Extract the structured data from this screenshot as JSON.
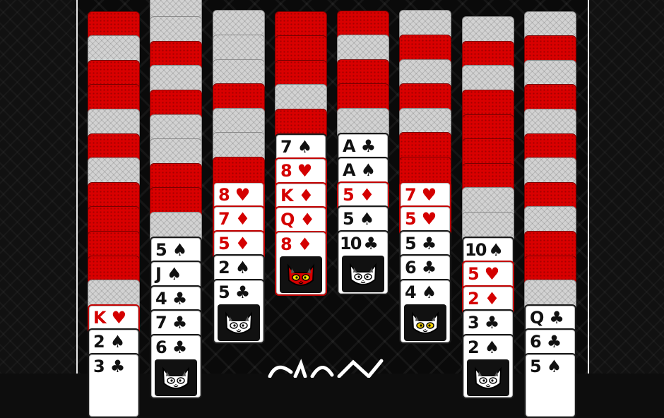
{
  "colors": {
    "back_red": "#d90000",
    "back_grey": "#d2d2d2",
    "board": "#0a0a0a",
    "red_suit": "#d40000",
    "black_suit": "#111111"
  },
  "columns": [
    {
      "backs": [
        "red",
        "grey",
        "red",
        "red",
        "grey",
        "red",
        "grey",
        "red",
        "red",
        "red",
        "red",
        "grey"
      ],
      "faces": [
        {
          "rank": "K",
          "suit": "♥"
        },
        {
          "rank": "2",
          "suit": "♠"
        },
        {
          "rank": "3",
          "suit": "♣"
        }
      ]
    },
    {
      "backs": [
        "grey",
        "grey",
        "red",
        "grey",
        "red",
        "grey",
        "grey",
        "red",
        "red",
        "grey"
      ],
      "faces": [
        {
          "rank": "5",
          "suit": "♠"
        },
        {
          "rank": "J",
          "suit": "♠"
        },
        {
          "rank": "4",
          "suit": "♣"
        },
        {
          "rank": "7",
          "suit": "♣"
        },
        {
          "rank": "6",
          "suit": "♣"
        }
      ],
      "cat": "white-cat-icon"
    },
    {
      "backs": [
        "grey",
        "grey",
        "grey",
        "red",
        "grey",
        "grey",
        "red"
      ],
      "faces": [
        {
          "rank": "8",
          "suit": "♥"
        },
        {
          "rank": "7",
          "suit": "♦"
        },
        {
          "rank": "5",
          "suit": "♦"
        },
        {
          "rank": "2",
          "suit": "♠"
        },
        {
          "rank": "5",
          "suit": "♣"
        }
      ],
      "cat": "white-cat-icon"
    },
    {
      "backs": [
        "red",
        "red",
        "red",
        "grey",
        "red"
      ],
      "faces": [
        {
          "rank": "7",
          "suit": "♠"
        },
        {
          "rank": "8",
          "suit": "♥"
        },
        {
          "rank": "K",
          "suit": "♦"
        },
        {
          "rank": "Q",
          "suit": "♦"
        },
        {
          "rank": "8",
          "suit": "♦"
        }
      ],
      "cat": "red-cat-icon"
    },
    {
      "backs": [
        "red",
        "grey",
        "red",
        "red",
        "grey"
      ],
      "faces": [
        {
          "rank": "A",
          "suit": "♣"
        },
        {
          "rank": "A",
          "suit": "♠"
        },
        {
          "rank": "5",
          "suit": "♦"
        },
        {
          "rank": "5",
          "suit": "♠"
        },
        {
          "rank": "10",
          "suit": "♣"
        }
      ],
      "cat": "white-cat-icon"
    },
    {
      "backs": [
        "grey",
        "red",
        "grey",
        "red",
        "grey",
        "red",
        "red"
      ],
      "faces": [
        {
          "rank": "7",
          "suit": "♥"
        },
        {
          "rank": "5",
          "suit": "♥"
        },
        {
          "rank": "5",
          "suit": "♣"
        },
        {
          "rank": "6",
          "suit": "♣"
        },
        {
          "rank": "4",
          "suit": "♠"
        }
      ],
      "cat": "yellow-eye-cat-icon"
    },
    {
      "backs": [
        "grey",
        "red",
        "grey",
        "red",
        "red",
        "red",
        "red",
        "grey",
        "grey"
      ],
      "faces": [
        {
          "rank": "10",
          "suit": "♠"
        },
        {
          "rank": "5",
          "suit": "♥"
        },
        {
          "rank": "2",
          "suit": "♦"
        },
        {
          "rank": "3",
          "suit": "♣"
        },
        {
          "rank": "2",
          "suit": "♠"
        }
      ],
      "cat": "white-cat-icon"
    },
    {
      "backs": [
        "grey",
        "red",
        "grey",
        "red",
        "grey",
        "red",
        "grey",
        "red",
        "grey",
        "red",
        "red",
        "grey"
      ],
      "faces": [
        {
          "rank": "Q",
          "suit": "♣"
        },
        {
          "rank": "6",
          "suit": "♣"
        },
        {
          "rank": "5",
          "suit": "♠"
        }
      ]
    }
  ]
}
